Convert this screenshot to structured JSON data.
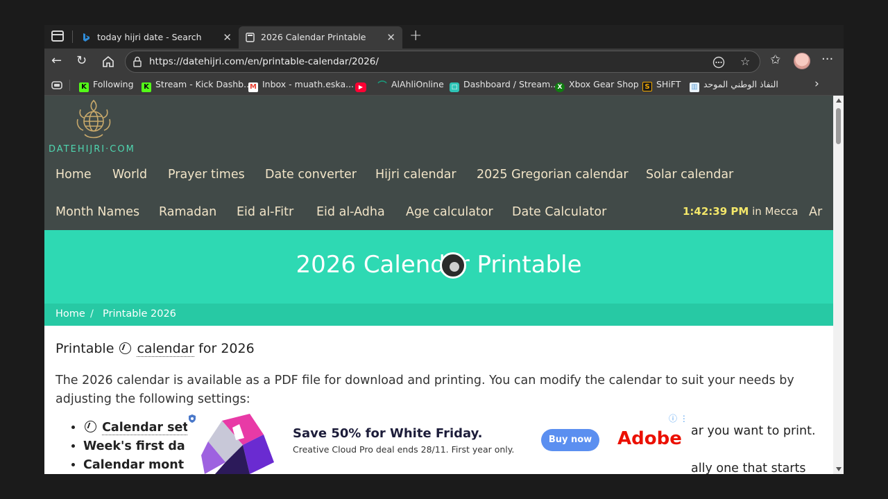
{
  "browser": {
    "tabs": [
      {
        "title": "today hijri date - Search",
        "icon": "bing-icon",
        "active": false
      },
      {
        "title": "2026 Calendar Printable",
        "icon": "page-icon",
        "active": true
      }
    ],
    "url": "https://datehijri.com/en/printable-calendar/2026/",
    "favorites": [
      {
        "label": "Following",
        "icon": "kick-icon",
        "color": "#53fc18"
      },
      {
        "label": "Stream - Kick Dashb...",
        "icon": "kick-icon",
        "color": "#53fc18"
      },
      {
        "label": "Inbox - muath.eska...",
        "icon": "gmail-icon",
        "color": "#ea4335"
      },
      {
        "label": "",
        "icon": "youtube-icon",
        "color": "#ff0033"
      },
      {
        "label": "AlAhliOnline",
        "icon": "alahli-icon",
        "color": "#1a9d7e"
      },
      {
        "label": "Dashboard / Stream...",
        "icon": "stream-icon",
        "color": "#2ec4b6"
      },
      {
        "label": "Xbox Gear Shop",
        "icon": "xbox-icon",
        "color": "#107c10"
      },
      {
        "label": "SHiFT",
        "icon": "shift-icon",
        "color": "#f2a900"
      },
      {
        "label": "النفاذ الوطني الموحد",
        "icon": "nafath-icon",
        "color": "#6aa7d8"
      }
    ]
  },
  "site": {
    "logo_text": "DATEHIJRI·COM",
    "nav_row1": [
      "Home",
      "World",
      "Prayer times",
      "Date converter",
      "Hijri calendar",
      "2025 Gregorian calendar",
      "Solar calendar"
    ],
    "nav_row2": [
      "Month Names",
      "Ramadan",
      "Eid al-Fitr",
      "Eid al-Adha",
      "Age calculator",
      "Date Calculator"
    ],
    "clock_time": "1:42:39 PM",
    "clock_place": "in Mecca",
    "lang_switch": "Ar",
    "hero_title": "2026 Calendar Printable",
    "breadcrumb": {
      "home": "Home",
      "sep": "/",
      "current": "Printable 2026"
    },
    "subheading": {
      "before": "Printable",
      "link": "calendar",
      "after": "for 2026"
    },
    "paragraph": "The 2026 calendar is available as a PDF file for download and printing. You can modify the calendar to suit your needs by adjusting the following settings:",
    "bullets": {
      "b1": "Calendar set",
      "b2": "Week's first da",
      "b3": "Calendar mont"
    },
    "right_fragments": {
      "r1": "ar you want to print.",
      "r3": "ally one that starts"
    }
  },
  "ad": {
    "headline": "Save 50% for White Friday.",
    "subline": "Creative Cloud Pro deal ends 28/11. First year only.",
    "button": "Buy now",
    "brand": "Adobe",
    "brand_color": "#eb1000",
    "button_color": "#5b8ff0"
  },
  "colors": {
    "header_bg": "#414a48",
    "nav_text": "#f2e5c8",
    "hero_bg": "#2ed9b3",
    "breadcrumb_bg": "#27c9a4",
    "clock_time": "#f3e76a"
  }
}
